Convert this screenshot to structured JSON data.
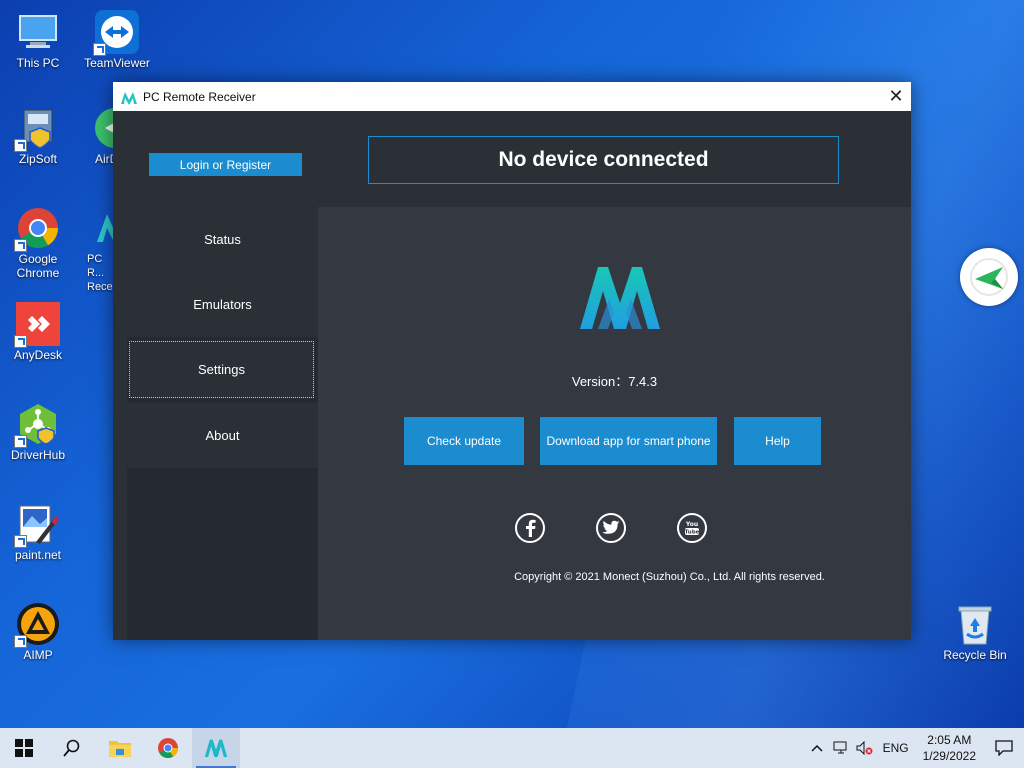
{
  "desktop": {
    "icons": [
      {
        "label": "This PC"
      },
      {
        "label": "TeamViewer"
      },
      {
        "label": "ZipSoft"
      },
      {
        "label": "AirD"
      },
      {
        "label": "Google Chrome"
      },
      {
        "label": "PC R... Rece..."
      },
      {
        "label": "AnyDesk"
      },
      {
        "label": "DriverHub"
      },
      {
        "label": "paint.net"
      },
      {
        "label": "AIMP"
      },
      {
        "label": "Recycle Bin"
      }
    ]
  },
  "window": {
    "title": "PC Remote Receiver",
    "close_glyph": "✕",
    "login_label": "Login or Register",
    "status_text": "No device connected",
    "nav": [
      {
        "label": "Status"
      },
      {
        "label": "Emulators"
      },
      {
        "label": "Settings",
        "selected": true
      },
      {
        "label": "About"
      }
    ],
    "version_text": "Version：7.4.3",
    "buttons": {
      "check_update": "Check update",
      "download_app": "Download app for smart phone",
      "help": "Help"
    },
    "social": [
      "facebook-icon",
      "twitter-icon",
      "youtube-icon"
    ],
    "copyright": "Copyright © 2021 Monect (Suzhou) Co., Ltd. All rights reserved."
  },
  "taskbar": {
    "lang": "ENG",
    "time": "2:05 AM",
    "date": "1/29/2022"
  },
  "colors": {
    "accent": "#1a8ccf",
    "window_bg": "#2b2f36",
    "content_bg": "#343841",
    "sidebar_bg": "#252a30"
  }
}
